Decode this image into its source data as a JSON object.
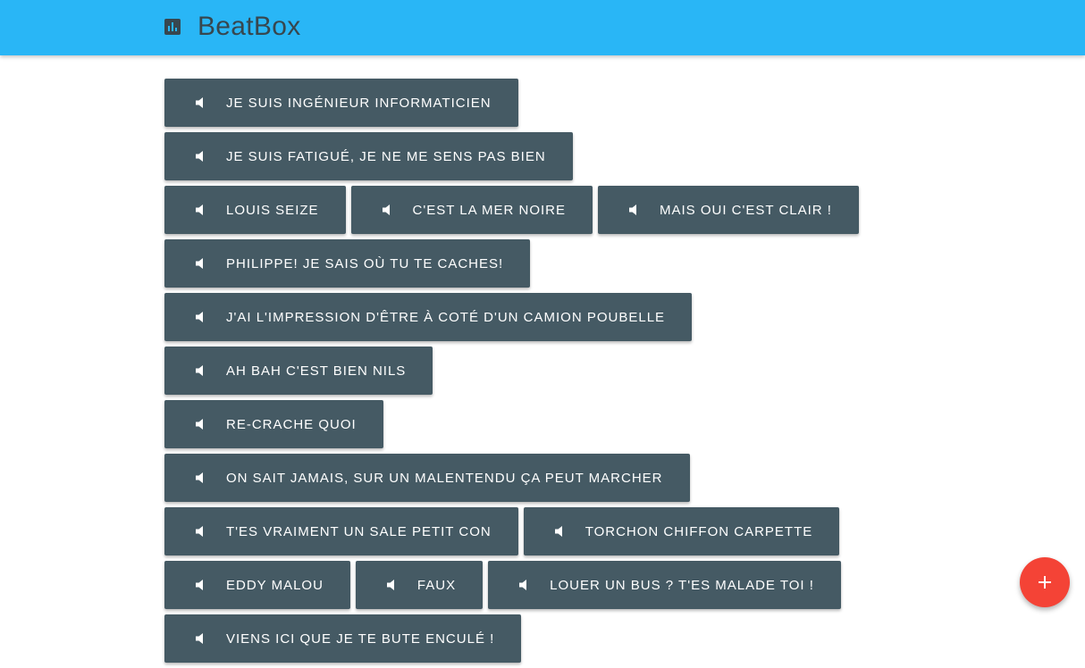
{
  "app": {
    "title": "BeatBox",
    "icon": "equalizer-icon",
    "toolbar_color": "#29b6f6"
  },
  "sounds": [
    {
      "label": "Je suis ingénieur informaticien",
      "icon": "volume-icon"
    },
    {
      "label": "Je suis fatigué, je ne me sens pas bien",
      "icon": "volume-icon"
    },
    {
      "label": "Louis Seize",
      "icon": "volume-icon"
    },
    {
      "label": "C'est la mer noire",
      "icon": "volume-icon"
    },
    {
      "label": "Mais oui c'est clair !",
      "icon": "volume-icon"
    },
    {
      "label": "Philippe! Je sais où tu te caches!",
      "icon": "volume-icon"
    },
    {
      "label": "J'ai l'impression d'être à coté d'un camion poubelle",
      "icon": "volume-icon"
    },
    {
      "label": "Ah bah c'est bien Nils",
      "icon": "volume-icon"
    },
    {
      "label": "Re-crache quoi",
      "icon": "volume-icon"
    },
    {
      "label": "On sait jamais, sur un malentendu ça peut marcher",
      "icon": "volume-icon"
    },
    {
      "label": "T'es vraiment un sale petit con",
      "icon": "volume-icon"
    },
    {
      "label": "Torchon chiffon carpette",
      "icon": "volume-icon"
    },
    {
      "label": "Eddy Malou",
      "icon": "volume-icon"
    },
    {
      "label": "Faux",
      "icon": "volume-icon"
    },
    {
      "label": "Louer un bus ? T'es malade toi !",
      "icon": "volume-icon"
    },
    {
      "label": "Viens ici que je te bute enculé !",
      "icon": "volume-icon"
    }
  ],
  "button_color": "#455a64",
  "fab": {
    "icon": "add-icon",
    "color": "#f44336"
  }
}
